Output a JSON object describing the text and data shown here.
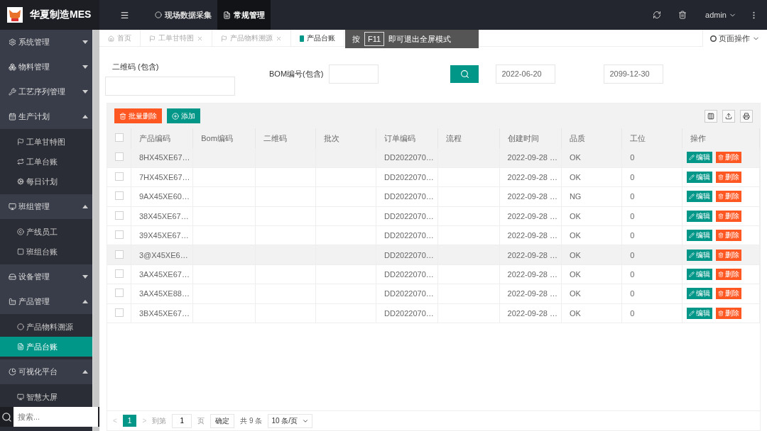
{
  "app": {
    "title": "华夏制造MES"
  },
  "top_nav": [
    {
      "label": "现场数据采集",
      "selected": false
    },
    {
      "label": "常规管理",
      "selected": true
    }
  ],
  "user": {
    "name": "admin"
  },
  "sidebar": {
    "items": [
      {
        "label": "系统管理",
        "expanded": false
      },
      {
        "label": "物料管理",
        "expanded": false
      },
      {
        "label": "工艺序列管理",
        "expanded": false
      },
      {
        "label": "生产计划",
        "expanded": true,
        "children": [
          {
            "label": "工单甘特图",
            "selected": false
          },
          {
            "label": "工单台账",
            "selected": false
          },
          {
            "label": "每日计划",
            "selected": false
          }
        ]
      },
      {
        "label": "班组管理",
        "expanded": true,
        "children": [
          {
            "label": "产线员工",
            "selected": false
          },
          {
            "label": "班组台账",
            "selected": false
          }
        ]
      },
      {
        "label": "设备管理",
        "expanded": false
      },
      {
        "label": "产品管理",
        "expanded": true,
        "children": [
          {
            "label": "产品物料溯源",
            "selected": false
          },
          {
            "label": "产品台账",
            "selected": true
          }
        ]
      },
      {
        "label": "可视化平台",
        "expanded": true,
        "children": [
          {
            "label": "智慧大屏",
            "selected": false
          }
        ]
      }
    ],
    "search": {
      "placeholder": "搜索..."
    }
  },
  "page_tabs": [
    {
      "label": "首页",
      "selected": false,
      "closable": false
    },
    {
      "label": "工单甘特图",
      "selected": false,
      "closable": true
    },
    {
      "label": "产品物料溯源",
      "selected": false,
      "closable": true
    },
    {
      "label": "产品台账",
      "selected": true,
      "closable": false
    }
  ],
  "page_actions": {
    "label": "页面操作"
  },
  "fullscreen_hint": {
    "prefix": "按",
    "key": "F11",
    "suffix": "即可退出全屏模式"
  },
  "filters": {
    "qr_label": "二维码 (包含)",
    "bom_label": "BOM编号(包含)",
    "date_from": "2022-06-20",
    "date_to": "2099-12-30"
  },
  "toolbar": {
    "batch_delete": "批量删除",
    "add": "添加"
  },
  "table": {
    "select_all_checked": false,
    "columns": [
      "产品编码",
      "Bom编码",
      "二维码",
      "批次",
      "订单编码",
      "流程",
      "创建时间",
      "品质",
      "工位",
      "操作"
    ],
    "rows": [
      {
        "selected": true,
        "checked": false,
        "product_code": "8HX45XE67…",
        "order_code": "DD2022070…",
        "created": "2022-09-28 …",
        "quality": "OK",
        "station": "0",
        "actions": [
          "编辑",
          "删除"
        ]
      },
      {
        "selected": false,
        "checked": false,
        "product_code": "7HX45XE67…",
        "order_code": "DD2022070…",
        "created": "2022-09-28 …",
        "quality": "OK",
        "station": "0",
        "actions": [
          "编辑",
          "删除"
        ]
      },
      {
        "selected": false,
        "checked": false,
        "product_code": "9AX45XE60…",
        "order_code": "DD2022070…",
        "created": "2022-09-28 …",
        "quality": "NG",
        "station": "0",
        "actions": [
          "编辑",
          "删除"
        ]
      },
      {
        "selected": false,
        "checked": false,
        "product_code": "38X45XE67…",
        "order_code": "DD2022070…",
        "created": "2022-09-28 …",
        "quality": "OK",
        "station": "0",
        "actions": [
          "编辑",
          "删除"
        ]
      },
      {
        "selected": false,
        "checked": false,
        "product_code": "39X45XE67…",
        "order_code": "DD2022070…",
        "created": "2022-09-28 …",
        "quality": "OK",
        "station": "0",
        "actions": [
          "编辑",
          "删除"
        ]
      },
      {
        "selected": true,
        "checked": false,
        "product_code": "3@X45XE6…",
        "order_code": "DD2022070…",
        "created": "2022-09-28 …",
        "quality": "OK",
        "station": "0",
        "actions": [
          "编辑",
          "删除"
        ]
      },
      {
        "selected": false,
        "checked": false,
        "product_code": "3AX45XE67…",
        "order_code": "DD2022070…",
        "created": "2022-09-28 …",
        "quality": "OK",
        "station": "0",
        "actions": [
          "编辑",
          "删除"
        ]
      },
      {
        "selected": false,
        "checked": false,
        "product_code": "3AX45XE88…",
        "order_code": "DD2022070…",
        "created": "2022-09-28 …",
        "quality": "OK",
        "station": "0",
        "actions": [
          "编辑",
          "删除"
        ]
      },
      {
        "selected": false,
        "checked": false,
        "product_code": "3BX45XE67…",
        "order_code": "DD2022070…",
        "created": "2022-09-28 …",
        "quality": "OK",
        "station": "0",
        "actions": [
          "编辑",
          "删除"
        ]
      }
    ]
  },
  "pagination": {
    "prev": "<",
    "current": "1",
    "next": ">",
    "goto_label": "到第",
    "goto_value": "1",
    "page_unit": "页",
    "confirm": "确定",
    "total": "共 9 条",
    "page_size": "10 条/页"
  }
}
